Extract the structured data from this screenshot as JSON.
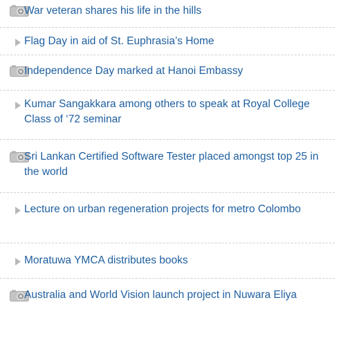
{
  "news": {
    "items": [
      {
        "title": "War veteran shares his life in the hills",
        "icon": "camera-icon"
      },
      {
        "title": "Flag Day in aid of St. Euphrasia’s Home",
        "icon": "bullet-arrow-icon"
      },
      {
        "title": "Independence Day marked at Hanoi Embassy",
        "icon": "camera-icon"
      },
      {
        "title": "Kumar Sangakkara among others to speak at Royal College Class of ‘72 seminar",
        "icon": "bullet-arrow-icon"
      },
      {
        "title": "Sri Lankan Certified Software Tester placed amongst top 25 in the world",
        "icon": "camera-icon"
      },
      {
        "title": "Lecture on urban regeneration projects for metro Colombo",
        "icon": "bullet-arrow-icon"
      },
      {
        "title": "Moratuwa YMCA distributes books",
        "icon": "bullet-arrow-icon"
      },
      {
        "title": "Australia and World Vision launch project in Nuwara Eliya",
        "icon": "camera-icon"
      }
    ]
  },
  "colors": {
    "link": "#1f5f9f",
    "separator": "#cfcfcf",
    "icon_gray": "#b8b8b8"
  }
}
